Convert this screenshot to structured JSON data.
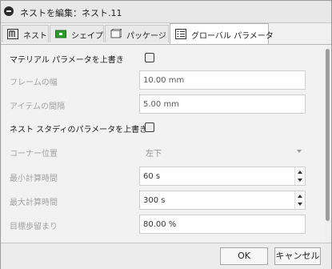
{
  "window": {
    "title": "ネストを編集：ネスト.11"
  },
  "tabs": [
    {
      "label": "ネスト",
      "icon": "nest-icon",
      "active": false
    },
    {
      "label": "シェイプ",
      "icon": "shape-icon",
      "active": false
    },
    {
      "label": "パッケージ",
      "icon": "package-icon",
      "active": false
    },
    {
      "label": "グローバル パラメータ",
      "icon": "global-parameters-icon",
      "active": true
    }
  ],
  "params": {
    "override_material_label": "マテリアル パラメータを上書き",
    "frame_width_label": "フレームの幅",
    "frame_width_value": "10.00 mm",
    "item_spacing_label": "アイテムの間隔",
    "item_spacing_value": "5.00 mm",
    "override_study_label": "ネスト スタディのパラメータを上書き",
    "corner_position_label": "コーナー位置",
    "corner_position_value": "左下",
    "min_calc_time_label": "最小計算時間",
    "min_calc_time_value": "60 s",
    "max_calc_time_label": "最大計算時間",
    "max_calc_time_value": "300 s",
    "target_yield_label": "目標歩留まり",
    "target_yield_value": "80.00 %"
  },
  "buttons": {
    "ok": "OK",
    "cancel": "キャンセル"
  },
  "colors": {
    "accent_green": "#2e9a2e",
    "disabled_text": "#a3a3a3"
  }
}
